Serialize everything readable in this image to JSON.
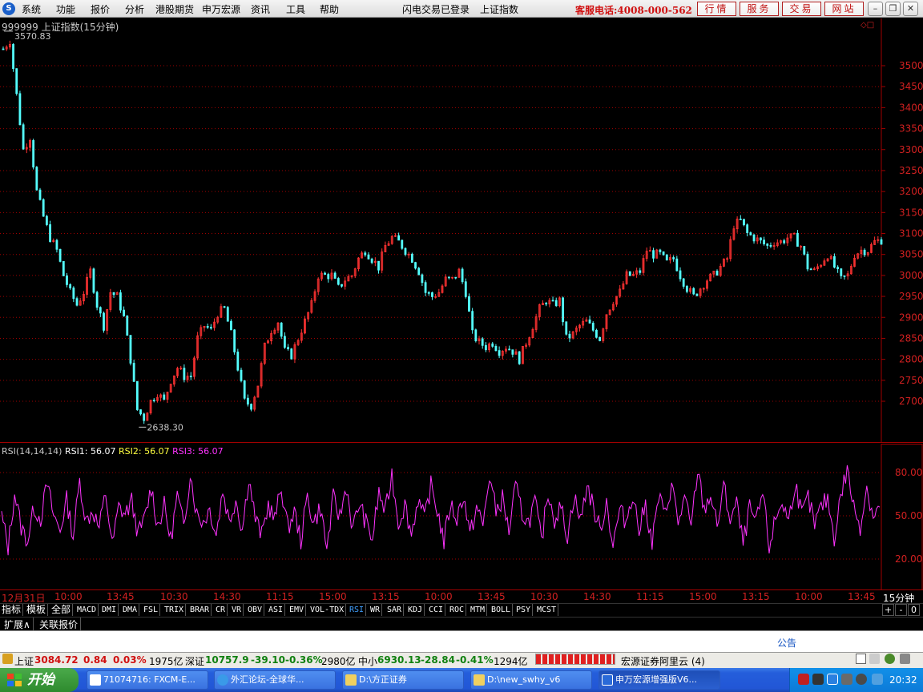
{
  "menu": {
    "items": [
      "系统",
      "功能",
      "报价",
      "分析",
      "港股期货",
      "申万宏源",
      "资讯",
      "工具",
      "帮助"
    ],
    "status": "闪电交易已登录",
    "index_name": "上证指数",
    "hotline": "客服电话:4008-000-562",
    "buttons": [
      "行情",
      "服务",
      "交易",
      "网站"
    ]
  },
  "chart": {
    "title": "999999 上证指数(15分钟)",
    "max_label": "3570.83",
    "min_label": "2638.30"
  },
  "rsi": {
    "name": "RSI(14,14,14)",
    "rsi1_label": "RSI1: 56.07",
    "rsi2_label": "RSI2: 56.07",
    "rsi3_label": "RSI3: 56.07"
  },
  "time_axis": {
    "labels": [
      "12月31日",
      "10:00",
      "13:45",
      "10:30",
      "14:30",
      "11:15",
      "15:00",
      "13:15",
      "10:00",
      "13:45",
      "10:30",
      "14:30",
      "11:15",
      "15:00",
      "13:15",
      "10:00",
      "13:45"
    ],
    "period": "15分钟"
  },
  "tabs": {
    "cn": [
      "指标",
      "模板",
      "全部"
    ],
    "indicators": [
      "MACD",
      "DMI",
      "DMA",
      "FSL",
      "TRIX",
      "BRAR",
      "CR",
      "VR",
      "OBV",
      "ASI",
      "EMV",
      "VOL-TDX",
      "RSI",
      "WR",
      "SAR",
      "KDJ",
      "CCI",
      "ROC",
      "MTM",
      "BOLL",
      "PSY",
      "MCST"
    ],
    "active": "RSI",
    "controls": [
      "+",
      "-",
      "0"
    ],
    "row2": [
      "扩展∧",
      "关联报价"
    ]
  },
  "notice": {
    "label": "公告"
  },
  "statusbar": {
    "sh_name": "上证",
    "sh_value": "3084.72",
    "sh_change": "0.84",
    "sh_pct": "0.03%",
    "sh_amount": "1975亿",
    "sz_name": "深证",
    "sz_value": "10757.9",
    "sz_change": "-39.10",
    "sz_pct": "-0.36%",
    "sz_amount": "2980亿",
    "zx_name": "中小",
    "zx_value": "6930.13",
    "zx_change": "-28.84",
    "zx_pct": "-0.41%",
    "zx_amount": "1294亿",
    "server": "宏源证券阿里云 (4)"
  },
  "taskbar": {
    "start": "开始",
    "tasks": [
      "71074716: FXCM-E...",
      "外汇论坛-全球华...",
      "D:\\方正证券",
      "D:\\new_swhy_v6",
      "申万宏源增强版V6..."
    ],
    "clock": "20:32"
  },
  "colors": {
    "up": "#ff3232",
    "down": "#54ffff",
    "rsi": "#ff33ff",
    "grid": "#a00000",
    "axis_text": "#d02020"
  },
  "chart_data": [
    {
      "type": "candlestick",
      "title": "999999 上证指数(15分钟)",
      "ylim": [
        2600,
        3600
      ],
      "yticks": [
        2700,
        2750,
        2800,
        2850,
        2900,
        2950,
        3000,
        3050,
        3100,
        3150,
        3200,
        3250,
        3300,
        3350,
        3400,
        3450,
        3500
      ],
      "max": 3570.83,
      "min": 2638.3,
      "x_labels": [
        "12月31日",
        "10:00",
        "13:45",
        "10:30",
        "14:30",
        "11:15",
        "15:00",
        "13:15",
        "10:00",
        "13:45",
        "10:30",
        "14:30",
        "11:15",
        "15:00",
        "13:15",
        "10:00",
        "13:45"
      ],
      "close_path": [
        [
          0,
          3540
        ],
        [
          2,
          3560
        ],
        [
          4,
          3430
        ],
        [
          6,
          3300
        ],
        [
          8,
          3330
        ],
        [
          10,
          3200
        ],
        [
          12,
          3140
        ],
        [
          14,
          3090
        ],
        [
          16,
          3060
        ],
        [
          18,
          3000
        ],
        [
          20,
          2960
        ],
        [
          22,
          2930
        ],
        [
          24,
          2960
        ],
        [
          26,
          3010
        ],
        [
          28,
          2930
        ],
        [
          30,
          2880
        ],
        [
          32,
          2960
        ],
        [
          34,
          2950
        ],
        [
          36,
          2900
        ],
        [
          38,
          2800
        ],
        [
          40,
          2680
        ],
        [
          42,
          2660
        ],
        [
          44,
          2700
        ],
        [
          46,
          2720
        ],
        [
          48,
          2700
        ],
        [
          50,
          2750
        ],
        [
          52,
          2780
        ],
        [
          54,
          2760
        ],
        [
          56,
          2760
        ],
        [
          58,
          2850
        ],
        [
          60,
          2880
        ],
        [
          62,
          2870
        ],
        [
          64,
          2910
        ],
        [
          66,
          2920
        ],
        [
          68,
          2860
        ],
        [
          70,
          2780
        ],
        [
          72,
          2700
        ],
        [
          74,
          2690
        ],
        [
          76,
          2740
        ],
        [
          78,
          2830
        ],
        [
          80,
          2870
        ],
        [
          82,
          2890
        ],
        [
          84,
          2820
        ],
        [
          86,
          2810
        ],
        [
          88,
          2850
        ],
        [
          90,
          2890
        ],
        [
          92,
          2930
        ],
        [
          94,
          3000
        ],
        [
          96,
          3000
        ],
        [
          98,
          3000
        ],
        [
          100,
          2970
        ],
        [
          102,
          2990
        ],
        [
          104,
          3000
        ],
        [
          106,
          3040
        ],
        [
          108,
          3060
        ],
        [
          110,
          3040
        ],
        [
          112,
          3020
        ],
        [
          114,
          3070
        ],
        [
          116,
          3090
        ],
        [
          118,
          3080
        ],
        [
          120,
          3060
        ],
        [
          122,
          3040
        ],
        [
          124,
          3010
        ],
        [
          126,
          2960
        ],
        [
          128,
          2950
        ],
        [
          130,
          2960
        ],
        [
          132,
          2990
        ],
        [
          134,
          2990
        ],
        [
          136,
          3010
        ],
        [
          138,
          2960
        ],
        [
          140,
          2860
        ],
        [
          142,
          2840
        ],
        [
          144,
          2830
        ],
        [
          146,
          2840
        ],
        [
          148,
          2820
        ],
        [
          150,
          2830
        ],
        [
          152,
          2820
        ],
        [
          154,
          2800
        ],
        [
          156,
          2840
        ],
        [
          158,
          2880
        ],
        [
          160,
          2920
        ],
        [
          162,
          2940
        ],
        [
          164,
          2930
        ],
        [
          166,
          2940
        ],
        [
          168,
          2850
        ],
        [
          170,
          2860
        ],
        [
          172,
          2880
        ],
        [
          174,
          2890
        ],
        [
          176,
          2870
        ],
        [
          178,
          2850
        ],
        [
          180,
          2910
        ],
        [
          182,
          2940
        ],
        [
          184,
          2960
        ],
        [
          186,
          3000
        ],
        [
          188,
          3000
        ],
        [
          190,
          3010
        ],
        [
          192,
          3060
        ],
        [
          194,
          3050
        ],
        [
          196,
          3050
        ],
        [
          198,
          3030
        ],
        [
          200,
          3040
        ],
        [
          202,
          3000
        ],
        [
          204,
          2970
        ],
        [
          206,
          2950
        ],
        [
          208,
          2970
        ],
        [
          210,
          2990
        ],
        [
          212,
          3000
        ],
        [
          214,
          3020
        ],
        [
          216,
          3040
        ],
        [
          218,
          3120
        ],
        [
          220,
          3130
        ],
        [
          222,
          3100
        ],
        [
          224,
          3090
        ],
        [
          226,
          3080
        ],
        [
          228,
          3070
        ],
        [
          230,
          3080
        ],
        [
          232,
          3080
        ],
        [
          234,
          3090
        ],
        [
          236,
          3090
        ],
        [
          238,
          3070
        ],
        [
          240,
          3020
        ],
        [
          242,
          3010
        ],
        [
          244,
          3030
        ],
        [
          246,
          3050
        ],
        [
          248,
          3020
        ],
        [
          250,
          2990
        ],
        [
          252,
          3000
        ],
        [
          254,
          3050
        ],
        [
          256,
          3060
        ],
        [
          258,
          3060
        ],
        [
          260,
          3080
        ],
        [
          262,
          3084.72
        ]
      ]
    },
    {
      "type": "line",
      "title": "RSI(14,14,14)",
      "ylim": [
        0,
        100
      ],
      "yticks": [
        20.0,
        50.0,
        80.0
      ],
      "series": [
        {
          "name": "RSI1",
          "values": [
            50,
            28,
            66,
            42,
            33,
            56,
            48,
            72,
            50,
            40,
            61,
            36,
            74,
            46,
            54,
            41,
            66,
            29,
            56,
            51,
            60,
            37,
            48,
            70,
            43,
            57,
            33,
            64,
            42,
            80,
            51,
            46,
            55,
            37,
            68,
            46,
            62,
            40,
            77,
            48,
            36,
            58,
            47,
            70,
            41,
            53,
            33,
            63,
            45,
            56,
            27,
            62,
            49,
            71,
            40,
            59,
            45,
            34,
            66,
            52,
            79,
            45,
            58,
            37,
            62,
            47,
            71,
            54,
            32,
            58,
            48,
            65,
            36,
            56,
            43,
            78,
            53,
            62,
            39,
            70,
            52,
            45,
            60,
            32,
            67,
            48,
            56,
            36,
            64,
            46,
            72,
            55,
            40,
            60,
            29,
            54,
            46,
            66,
            40,
            58,
            31,
            63,
            50,
            73,
            45,
            62,
            41,
            82,
            54,
            65,
            42,
            70,
            48,
            58,
            30,
            55,
            44,
            66,
            28,
            48,
            60,
            46,
            74,
            50,
            62,
            43,
            56,
            62,
            35,
            64,
            82,
            56,
            43,
            70,
            50,
            56
          ]
        }
      ]
    }
  ]
}
